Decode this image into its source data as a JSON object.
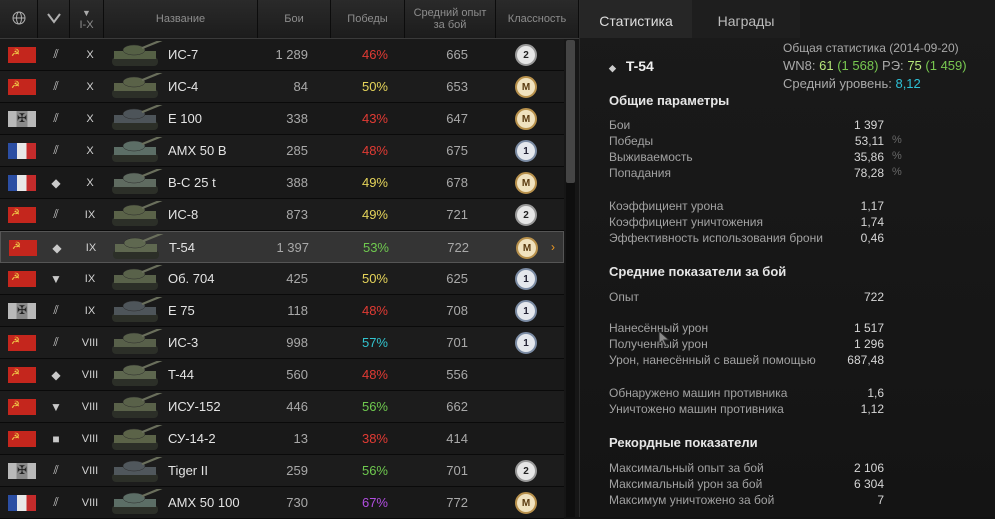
{
  "header": {
    "globe_icon": "globe-icon",
    "class_filter_icon": "class-filter-icon",
    "tier_label": "I-X",
    "name_label": "Название",
    "battles_label": "Бои",
    "wins_label": "Победы",
    "avg_exp_label": "Средний опыт за бой",
    "mastery_label": "Классность"
  },
  "rows": [
    {
      "nation": "ussr",
      "cls": "⫽",
      "tier": "X",
      "name": "ИС-7",
      "battles": "1 289",
      "wins": "46%",
      "wins_color": "#e23b34",
      "exp": "665",
      "badge": "2",
      "tank_color": "#556045"
    },
    {
      "nation": "ussr",
      "cls": "⫽",
      "tier": "X",
      "name": "ИС-4",
      "battles": "84",
      "wins": "50%",
      "wins_color": "#e5d45a",
      "exp": "653",
      "badge": "M",
      "tank_color": "#5a6248"
    },
    {
      "nation": "ger",
      "cls": "⫽",
      "tier": "X",
      "name": "E 100",
      "battles": "338",
      "wins": "43%",
      "wins_color": "#e23b34",
      "exp": "647",
      "badge": "M",
      "tank_color": "#4d5459"
    },
    {
      "nation": "fra",
      "cls": "⫽",
      "tier": "X",
      "name": "AMX 50 B",
      "battles": "285",
      "wins": "48%",
      "wins_color": "#e23b34",
      "exp": "675",
      "badge": "1",
      "tank_color": "#5c6e66"
    },
    {
      "nation": "fra",
      "cls": "◆",
      "tier": "X",
      "name": "B-C 25 t",
      "battles": "388",
      "wins": "49%",
      "wins_color": "#e5d45a",
      "exp": "678",
      "badge": "M",
      "tank_color": "#5f6b60"
    },
    {
      "nation": "ussr",
      "cls": "⫽",
      "tier": "IX",
      "name": "ИС-8",
      "battles": "873",
      "wins": "49%",
      "wins_color": "#e5d45a",
      "exp": "721",
      "badge": "2",
      "tank_color": "#5a6248"
    },
    {
      "nation": "ussr",
      "cls": "◆",
      "tier": "IX",
      "name": "T-54",
      "battles": "1 397",
      "wins": "53%",
      "wins_color": "#6fc94f",
      "exp": "722",
      "badge": "M",
      "tank_color": "#5f6850",
      "selected": true
    },
    {
      "nation": "ussr",
      "cls": "▼",
      "tier": "IX",
      "name": "Об. 704",
      "battles": "425",
      "wins": "50%",
      "wins_color": "#e5d45a",
      "exp": "625",
      "badge": "1",
      "tank_color": "#59624a"
    },
    {
      "nation": "ger",
      "cls": "⫽",
      "tier": "IX",
      "name": "E 75",
      "battles": "118",
      "wins": "48%",
      "wins_color": "#e23b34",
      "exp": "708",
      "badge": "1",
      "tank_color": "#4e555a"
    },
    {
      "nation": "ussr",
      "cls": "⫽",
      "tier": "VIII",
      "name": "ИС-3",
      "battles": "998",
      "wins": "57%",
      "wins_color": "#32c4cf",
      "exp": "701",
      "badge": "1",
      "tank_color": "#58604a"
    },
    {
      "nation": "ussr",
      "cls": "◆",
      "tier": "VIII",
      "name": "T-44",
      "battles": "560",
      "wins": "48%",
      "wins_color": "#e23b34",
      "exp": "556",
      "badge": "",
      "tank_color": "#5d664e"
    },
    {
      "nation": "ussr",
      "cls": "▼",
      "tier": "VIII",
      "name": "ИСУ-152",
      "battles": "446",
      "wins": "56%",
      "wins_color": "#6fc94f",
      "exp": "662",
      "badge": "",
      "tank_color": "#596149"
    },
    {
      "nation": "ussr",
      "cls": "■",
      "tier": "VIII",
      "name": "СУ-14-2",
      "battles": "13",
      "wins": "38%",
      "wins_color": "#e23b34",
      "exp": "414",
      "badge": "",
      "tank_color": "#5b6348"
    },
    {
      "nation": "ger",
      "cls": "⫽",
      "tier": "VIII",
      "name": "Tiger II",
      "battles": "259",
      "wins": "56%",
      "wins_color": "#6fc94f",
      "exp": "701",
      "badge": "2",
      "tank_color": "#50575c"
    },
    {
      "nation": "fra",
      "cls": "⫽",
      "tier": "VIII",
      "name": "AMX 50 100",
      "battles": "730",
      "wins": "67%",
      "wins_color": "#b14ee0",
      "exp": "772",
      "badge": "M",
      "tank_color": "#5c6e66"
    }
  ],
  "selected_arrow": "›",
  "tabs": {
    "stats": "Статистика",
    "awards": "Награды"
  },
  "general": {
    "title": "Общая статистика (2014-09-20)",
    "wn8_label": "WN8:",
    "wn8": "61",
    "wn8_paren": "(1 568)",
    "re_label": "РЭ:",
    "re": "75",
    "re_paren": "(1 459)",
    "avg_level_label": "Средний уровень:",
    "avg_level": "8,12"
  },
  "tank_title": "T-54",
  "tank_title_icon": "light-tank-icon",
  "sections": {
    "general": "Общие параметры",
    "avg": "Средние показатели за бой",
    "records": "Рекордные показатели"
  },
  "stats": [
    {
      "label": "Бои",
      "value": "1 397",
      "pct": ""
    },
    {
      "label": "Победы",
      "value": "53,11",
      "pct": "%"
    },
    {
      "label": "Выживаемость",
      "value": "35,86",
      "pct": "%"
    },
    {
      "label": "Попадания",
      "value": "78,28",
      "pct": "%"
    },
    {
      "label": "Коэффициент урона",
      "value": "1,17",
      "pct": ""
    },
    {
      "label": "Коэффициент уничтожения",
      "value": "1,74",
      "pct": ""
    },
    {
      "label": "Эффективность использования брони",
      "value": "0,46",
      "pct": ""
    },
    {
      "label": "Опыт",
      "value": "722",
      "pct": ""
    },
    {
      "label": "Нанесённый урон",
      "value": "1 517",
      "pct": ""
    },
    {
      "label": "Полученный урон",
      "value": "1 296",
      "pct": ""
    },
    {
      "label": "Урон, нанесённый с вашей помощью",
      "value": "687,48",
      "pct": ""
    },
    {
      "label": "Обнаружено машин противника",
      "value": "1,6",
      "pct": ""
    },
    {
      "label": "Уничтожено машин противника",
      "value": "1,12",
      "pct": ""
    },
    {
      "label": "Максимальный опыт за бой",
      "value": "2 106",
      "pct": ""
    },
    {
      "label": "Максимальный урон за бой",
      "value": "6 304",
      "pct": ""
    },
    {
      "label": "Максимум уничтожено за бой",
      "value": "7",
      "pct": ""
    }
  ]
}
